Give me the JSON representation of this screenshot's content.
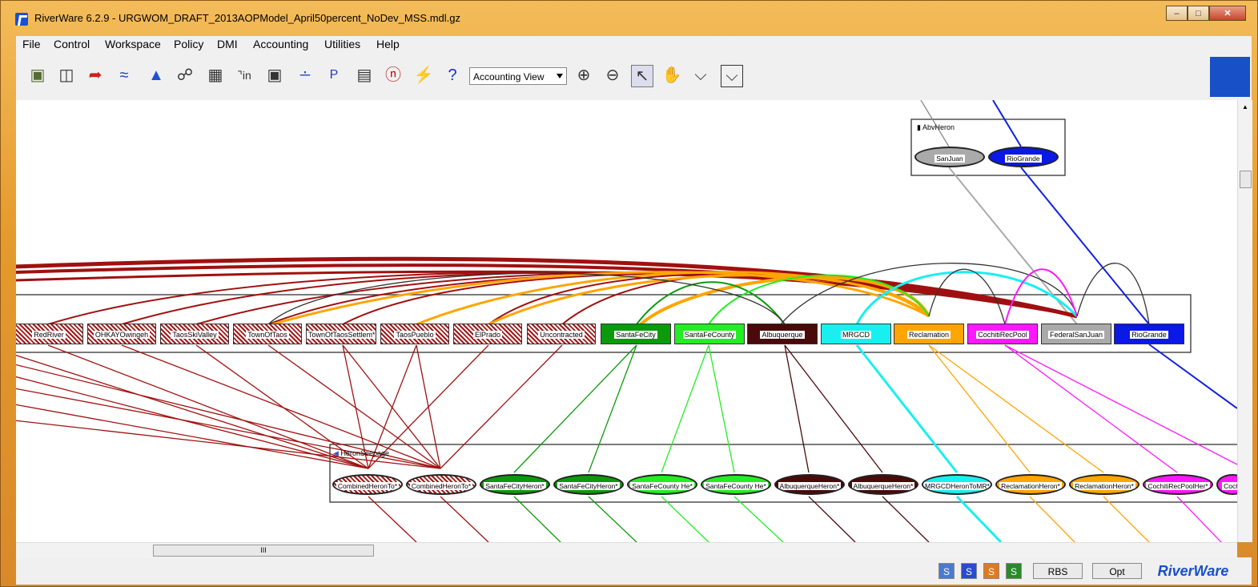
{
  "window": {
    "title": "RiverWare 6.2.9 - URGWOM_DRAFT_2013AOPModel_April50percent_NoDev_MSS.mdl.gz"
  },
  "menu": [
    "File",
    "Control",
    "Workspace",
    "Policy",
    "DMI",
    "Accounting",
    "Utilities",
    "Help"
  ],
  "toolbar": {
    "view_selector": "Accounting View",
    "icons": [
      "open-icon",
      "save-icon",
      "run-icon",
      "multirun-icon",
      "triangle-icon",
      "link-icon",
      "grid-icon",
      "input-icon",
      "camera-icon",
      "chart-icon",
      "plot-icon",
      "database-icon",
      "dmi-icon",
      "lightning-icon",
      "help-icon"
    ],
    "tools": [
      "zoom-in-icon",
      "zoom-out-icon",
      "pointer-icon",
      "hand-icon",
      "telescope-icon",
      "telescope-box-icon"
    ]
  },
  "groups": {
    "abv_heron": "AbvHeron",
    "heron_seepage": "HeronSeepage"
  },
  "top_nodes": [
    {
      "label": "SanJuan",
      "color": "#aaaaaa"
    },
    {
      "label": "RioGrande",
      "color": "#0a18e8"
    }
  ],
  "middle_nodes": [
    {
      "label": "RedRiver",
      "color": "#a01818",
      "hatched": true
    },
    {
      "label": "OHKAYOwingeh",
      "color": "#a01818",
      "hatched": true
    },
    {
      "label": "TaosSkiValley",
      "color": "#a01818",
      "hatched": true
    },
    {
      "label": "TownOfTaos",
      "color": "#a01818",
      "hatched": true
    },
    {
      "label": "TownOfTaosSettlem*",
      "color": "#a01818",
      "hatched": true
    },
    {
      "label": "TaosPueblo",
      "color": "#a01818",
      "hatched": true
    },
    {
      "label": "ElPrado",
      "color": "#a01818",
      "hatched": true
    },
    {
      "label": "Uncontracted",
      "color": "#a01818",
      "hatched": true
    },
    {
      "label": "SantaFeCity",
      "color": "#0b9a0b",
      "hatched": false
    },
    {
      "label": "SantaFeCounty",
      "color": "#22ee22",
      "hatched": false
    },
    {
      "label": "Albuquerque",
      "color": "#4a0a0a",
      "hatched": false
    },
    {
      "label": "MRGCD",
      "color": "#18f0f0",
      "hatched": false
    },
    {
      "label": "Reclamation",
      "color": "#ffa500",
      "hatched": false
    },
    {
      "label": "CochitiRecPool",
      "color": "#ff18ff",
      "hatched": false
    },
    {
      "label": "FederalSanJuan",
      "color": "#aaaaaa",
      "hatched": false
    },
    {
      "label": "RioGrande",
      "color": "#0a18e8",
      "hatched": false
    }
  ],
  "bottom_nodes": [
    {
      "label": "CombinedHeronTo*",
      "color": "#a01818",
      "hatched": true
    },
    {
      "label": "CombinedHeronTo*",
      "color": "#a01818",
      "hatched": true
    },
    {
      "label": "SantaFeCityHeron*",
      "color": "#0b9a0b",
      "hatched": false
    },
    {
      "label": "SantaFeCityHeron*",
      "color": "#0b9a0b",
      "hatched": false
    },
    {
      "label": "SantaFeCounty He*",
      "color": "#22ee22",
      "hatched": false
    },
    {
      "label": "SantaFeCounty He*",
      "color": "#22ee22",
      "hatched": false
    },
    {
      "label": "AlbuquerqueHeron*",
      "color": "#4a0a0a",
      "hatched": false
    },
    {
      "label": "AlbuquerqueHeron*",
      "color": "#4a0a0a",
      "hatched": false
    },
    {
      "label": "MRGCDHeronToMR*",
      "color": "#18f0f0",
      "hatched": false
    },
    {
      "label": "ReclamationHeron*",
      "color": "#ffa500",
      "hatched": false
    },
    {
      "label": "ReclamationHeron*",
      "color": "#ffa500",
      "hatched": false
    },
    {
      "label": "CochitiRecPoolHer*",
      "color": "#ff18ff",
      "hatched": false
    },
    {
      "label": "Cochi",
      "color": "#ff18ff",
      "hatched": false
    }
  ],
  "scrollbar": {
    "thumb_label": "III"
  },
  "status": {
    "s_buttons": [
      "S",
      "S",
      "S",
      "S"
    ],
    "s_colors": [
      "#4a7ad0",
      "#2a4ad0",
      "#e07a20",
      "#2a8a2a"
    ],
    "rbs": "RBS",
    "opt": "Opt",
    "brand": "RiverWare"
  }
}
